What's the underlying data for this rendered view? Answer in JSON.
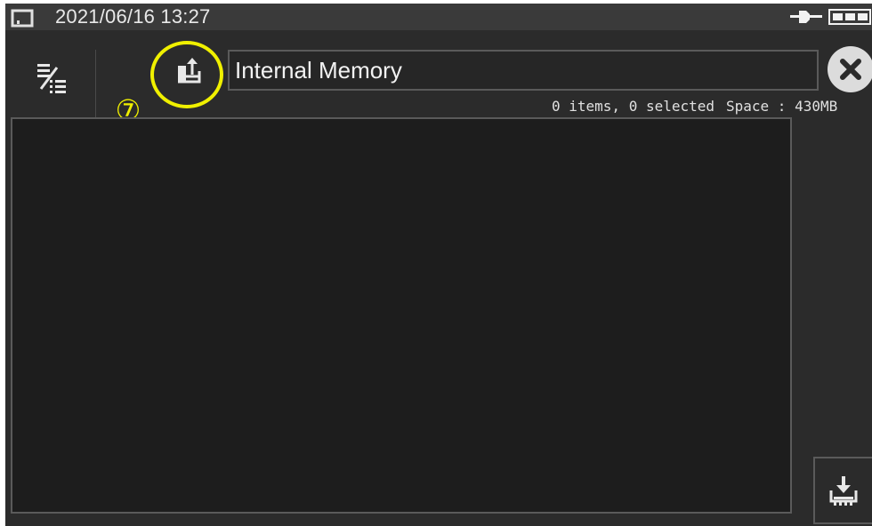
{
  "status_bar": {
    "datetime": "2021/06/16 13:27",
    "icons": [
      "sd-card-icon",
      "power-plug-icon",
      "battery-icon"
    ]
  },
  "toolbar": {
    "menu_icon": "list-view-icon",
    "up_icon": "folder-up-icon",
    "location": "Internal Memory",
    "close_icon": "close-icon"
  },
  "annotation": {
    "number": "⑦",
    "color": "#f0f000"
  },
  "info": {
    "items_text": "0 items, 0 selected",
    "space_text": "Space : 430MB"
  },
  "file_list": {
    "items": []
  },
  "actions": {
    "save_icon": "save-download-icon"
  },
  "colors": {
    "background": "#2b2b2b",
    "list_background": "#1d1d1d",
    "accent_annotation": "#f0f000"
  }
}
